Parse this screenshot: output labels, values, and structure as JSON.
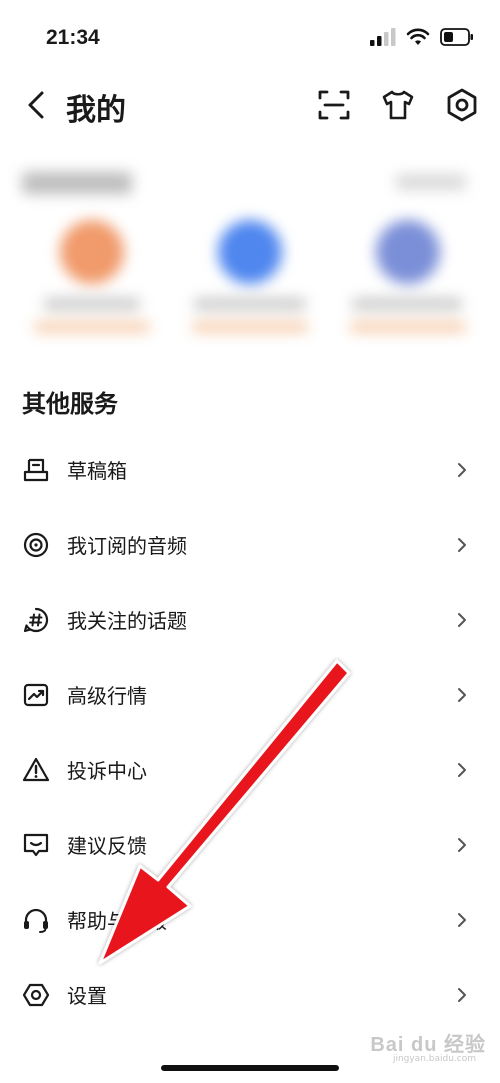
{
  "status_bar": {
    "time": "21:34"
  },
  "nav": {
    "title": "我的"
  },
  "services": {
    "title": "其他服务",
    "items": [
      {
        "label": "草稿箱",
        "icon": "draft-box-icon"
      },
      {
        "label": "我订阅的音频",
        "icon": "audio-disc-icon"
      },
      {
        "label": "我关注的话题",
        "icon": "hashtag-icon"
      },
      {
        "label": "高级行情",
        "icon": "market-chart-icon"
      },
      {
        "label": "投诉中心",
        "icon": "warning-icon"
      },
      {
        "label": "建议反馈",
        "icon": "feedback-icon"
      },
      {
        "label": "帮助与客服",
        "icon": "headset-icon"
      },
      {
        "label": "设置",
        "icon": "settings-hexagon-icon"
      }
    ]
  },
  "watermark": {
    "brand": "Bai du 经验",
    "url": "jingyan.baidu.com"
  },
  "colors": {
    "arrow": "#e8141b",
    "text": "#1a1a1a",
    "chevron": "#555555"
  }
}
